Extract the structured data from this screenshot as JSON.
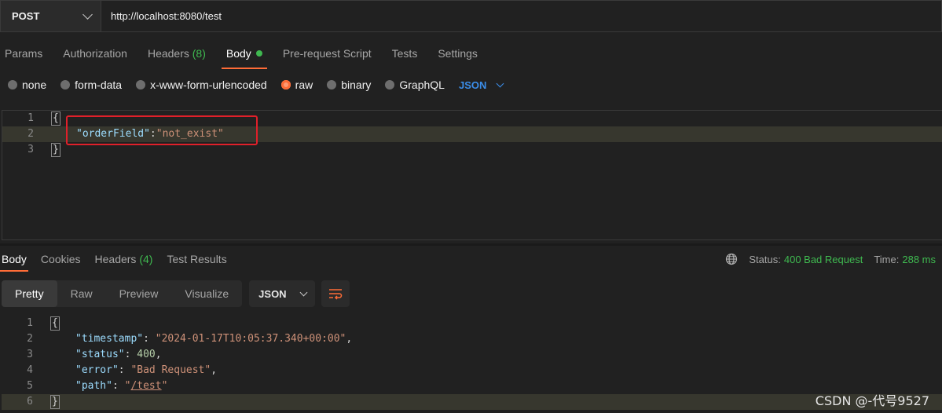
{
  "request": {
    "method": "POST",
    "url": "http://localhost:8080/test"
  },
  "request_tabs": [
    {
      "label": "Params"
    },
    {
      "label": "Authorization"
    },
    {
      "label": "Headers",
      "count": "(8)"
    },
    {
      "label": "Body"
    },
    {
      "label": "Pre-request Script"
    },
    {
      "label": "Tests"
    },
    {
      "label": "Settings"
    }
  ],
  "body_types": {
    "none": "none",
    "form_data": "form-data",
    "urlencoded": "x-www-form-urlencoded",
    "raw": "raw",
    "binary": "binary",
    "graphql": "GraphQL",
    "language": "JSON",
    "selected": "raw"
  },
  "request_body": {
    "line_numbers": [
      "1",
      "2",
      "3"
    ],
    "open_brace": "{",
    "key": "\"orderField\"",
    "colon": ":",
    "value": "\"not_exist\"",
    "close_brace": "}"
  },
  "response_tabs": [
    {
      "label": "Body"
    },
    {
      "label": "Cookies"
    },
    {
      "label": "Headers",
      "count": "(4)"
    },
    {
      "label": "Test Results"
    }
  ],
  "status": {
    "status_label": "Status:",
    "status_value": "400 Bad Request",
    "time_label": "Time:",
    "time_value": "288 ms"
  },
  "view_modes": {
    "pretty": "Pretty",
    "raw": "Raw",
    "preview": "Preview",
    "visualize": "Visualize",
    "format": "JSON"
  },
  "response_body": {
    "line_numbers": [
      "1",
      "2",
      "3",
      "4",
      "5",
      "6"
    ],
    "open_brace": "{",
    "timestamp_key": "\"timestamp\"",
    "timestamp_value": "\"2024-01-17T10:05:37.340+00:00\"",
    "status_key": "\"status\"",
    "status_value": "400",
    "error_key": "\"error\"",
    "error_value": "\"Bad Request\"",
    "path_key": "\"path\"",
    "path_quote_open": "\"",
    "path_value": "/test",
    "path_quote_close": "\"",
    "close_brace": "}"
  },
  "watermark": "CSDN @-代号9527",
  "colors": {
    "accent": "#ff6c37",
    "success": "#3fb950",
    "link": "#3b8eea",
    "highlight_box": "#e0202a"
  }
}
